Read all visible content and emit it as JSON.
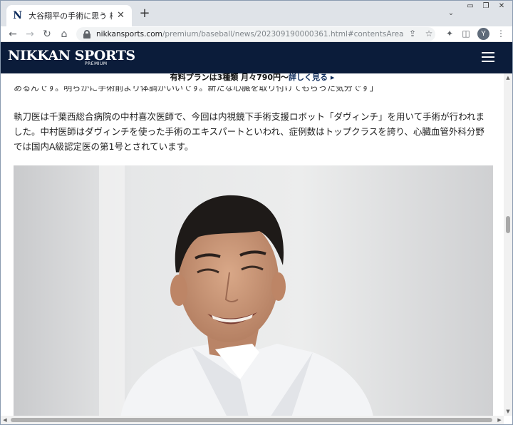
{
  "browser": {
    "tab": {
      "favicon": "N",
      "title": "大谷翔平の手術に思う 松井秀喜の",
      "close_icon": "close-icon"
    },
    "new_tab_label": "+",
    "tab_search_icon": "chevron-down-icon",
    "window_controls": [
      "minimize-icon",
      "maximize-icon",
      "close-icon"
    ],
    "toolbar": {
      "back_glyph": "←",
      "forward_glyph": "→",
      "reload_glyph": "↻",
      "home_glyph": "⌂",
      "url_host": "nikkansports.com",
      "url_path": "/premium/baseball/news/202309190000361.html#contentsArea",
      "share_glyph": "⇪",
      "bookmark_glyph": "☆",
      "extensions_glyph": "✦",
      "sidepanel_glyph": "◫",
      "profile_initial": "Y",
      "menu_glyph": "⋮"
    }
  },
  "site": {
    "logo_text": "NIKKAN SPORTS",
    "logo_sub": "PREMIUM",
    "menu_icon": "hamburger-icon",
    "brand_color": "#0b1c3a"
  },
  "article": {
    "promo_prefix": "有料プランは3種類 月々790円〜",
    "promo_link": "詳しく見る ▸",
    "cut_quote": "あるんです。明らかに手術前より体調がいいです。新たな心臓を取り付けてもらった気分です」",
    "paragraph": "執刀医は千葉西総合病院の中村喜次医師で、今回は内視鏡下手術支援ロボット「ダヴィンチ」を用いて手術が行われました。中村医師はダヴィンチを使った手術のエキスパートといわれ、症例数はトップクラスを誇り、心臓血管外科分野では国内A級認定医の第1号とされています。"
  }
}
